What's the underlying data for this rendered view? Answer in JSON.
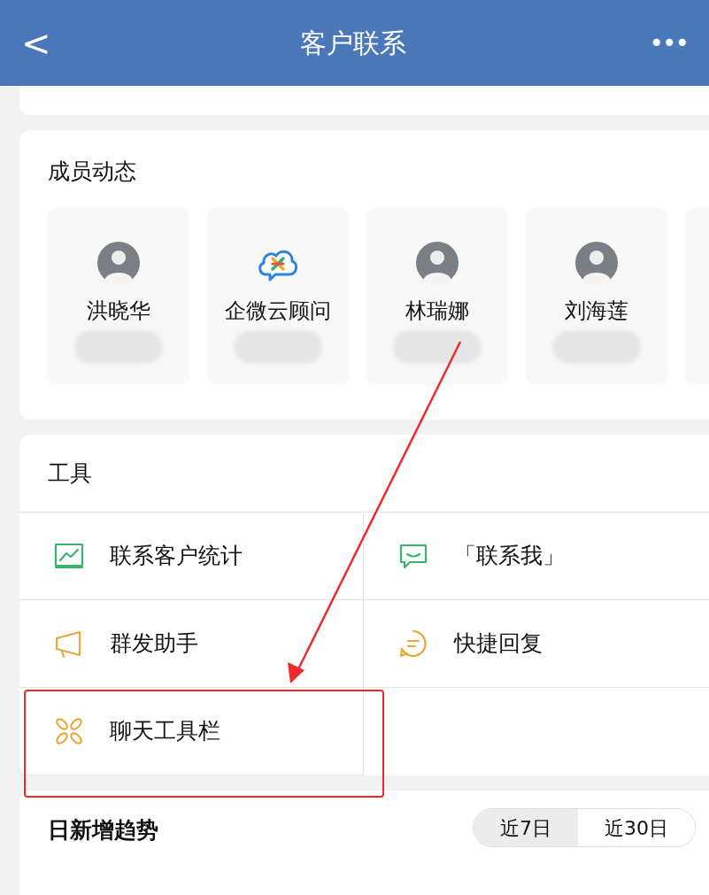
{
  "header": {
    "back": "<",
    "title": "客户联系",
    "more": "•••"
  },
  "members": {
    "title": "成员动态",
    "items": [
      {
        "name": "洪晓华",
        "kind": "person"
      },
      {
        "name": "企微云顾问",
        "kind": "logo"
      },
      {
        "name": "林瑞娜",
        "kind": "person"
      },
      {
        "name": "刘海莲",
        "kind": "person"
      }
    ]
  },
  "tools": {
    "title": "工具",
    "items": [
      {
        "label": "联系客户统计",
        "kind": "chart",
        "color": "#3bb36a"
      },
      {
        "label": "「联系我」",
        "kind": "chat",
        "color": "#3bb36a"
      },
      {
        "label": "群发助手",
        "kind": "megaphone",
        "color": "#e8a93a"
      },
      {
        "label": "快捷回复",
        "kind": "reply",
        "color": "#e8a93a"
      },
      {
        "label": "聊天工具栏",
        "kind": "apps",
        "color": "#e8a93a"
      }
    ]
  },
  "trend": {
    "title": "日新增趋势",
    "ranges": [
      {
        "label": "近7日",
        "selected": true
      },
      {
        "label": "近30日",
        "selected": false
      }
    ]
  }
}
